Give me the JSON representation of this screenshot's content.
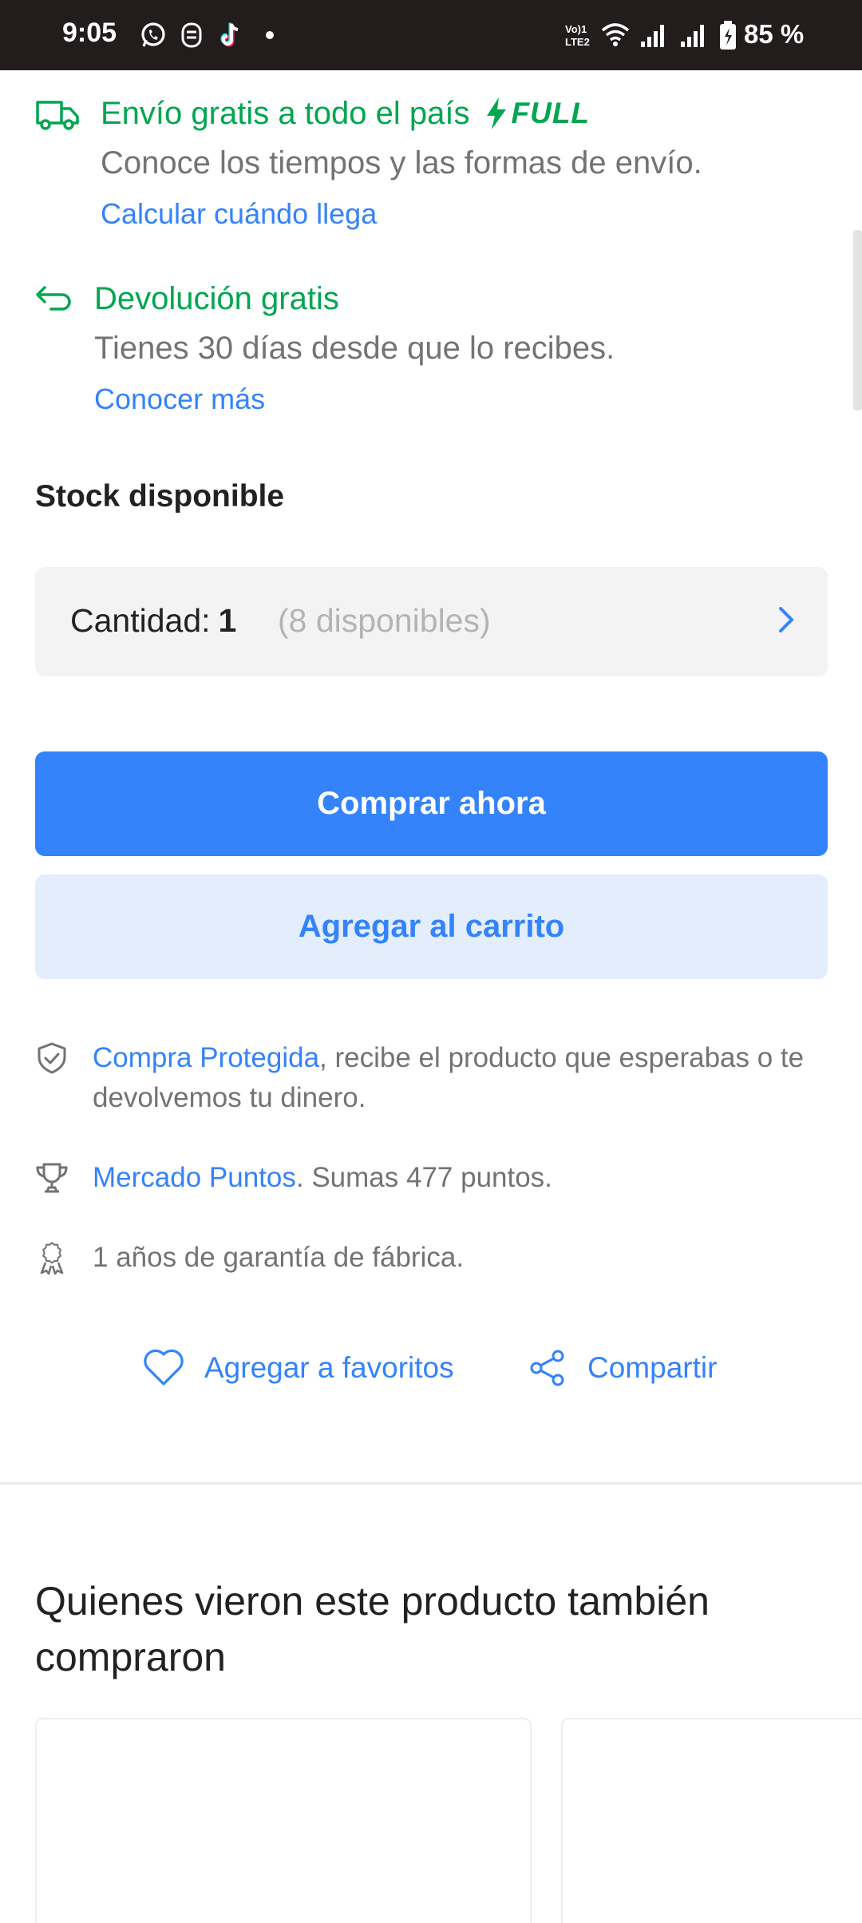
{
  "status_bar": {
    "time": "9:05",
    "battery_pct": "85 %",
    "icons": [
      "whatsapp-icon",
      "messenger-icon",
      "tiktok-icon",
      "dot-icon",
      "volte-icon",
      "wifi-icon",
      "signal-icon",
      "signal-icon-2",
      "battery-icon"
    ]
  },
  "shipping": {
    "title": "Envío gratis a todo el país",
    "badge": "FULL",
    "subtitle": "Conoce los tiempos y las formas de envío.",
    "link": "Calcular cuándo llega"
  },
  "returns": {
    "title": "Devolución gratis",
    "subtitle": "Tienes 30 días desde que lo recibes.",
    "link": "Conocer más"
  },
  "stock": {
    "label": "Stock disponible",
    "quantity_label": "Cantidad:",
    "quantity_value": "1",
    "available": "(8 disponibles)"
  },
  "buttons": {
    "buy_now": "Comprar ahora",
    "add_to_cart": "Agregar al carrito"
  },
  "benefits": {
    "protected_link": "Compra Protegida",
    "protected_text": ", recibe el producto que esperabas o te devolvemos tu dinero.",
    "points_link": "Mercado Puntos",
    "points_text": ". Sumas 477 puntos.",
    "warranty_text": "1 años de garantía de fábrica."
  },
  "actions": {
    "favorites": "Agregar a favoritos",
    "share": "Compartir"
  },
  "recommendations": {
    "title": "Quienes vieron este producto también compraron"
  },
  "colors": {
    "green": "#00a650",
    "blue": "#3483fa",
    "status_bar": "#221c1c"
  }
}
